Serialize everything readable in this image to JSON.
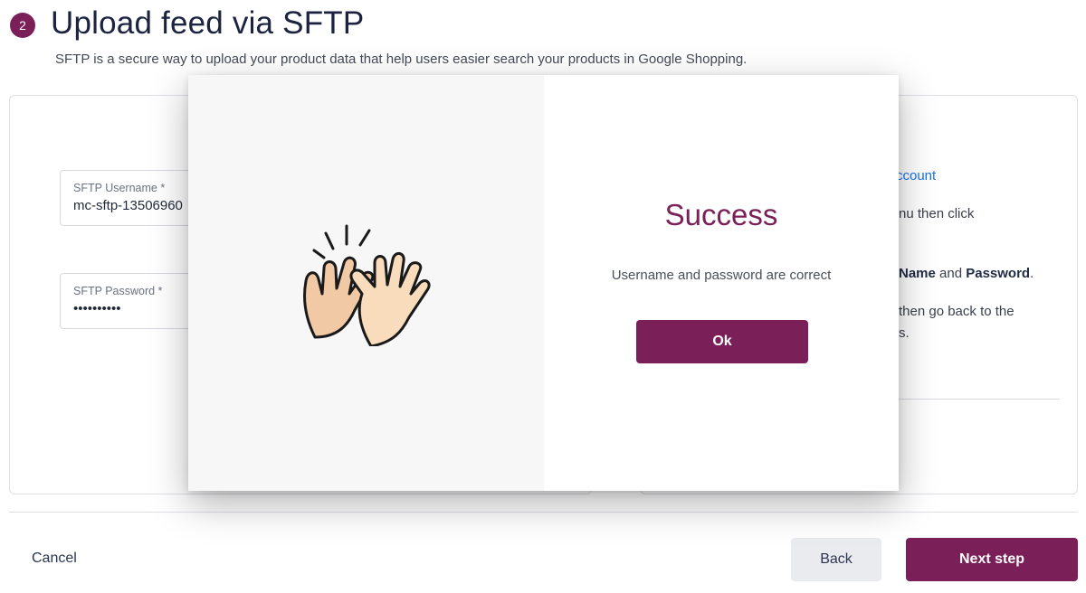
{
  "header": {
    "step_number": "2",
    "title": "Upload feed via SFTP",
    "subtitle": "SFTP is a secure way to upload your product data that help users easier search your products in Google Shopping."
  },
  "form": {
    "username": {
      "label": "SFTP Username *",
      "value": "mc-sftp-13506960"
    },
    "password": {
      "label": "SFTP Password *",
      "value": "••••••••••"
    }
  },
  "instructions": {
    "link_fragment": "ccount",
    "line2": "nu then click",
    "line3_bold1": "Name",
    "line3_mid": " and ",
    "line3_bold2": "Password",
    "line3_end": ".",
    "line4": "then go back to the",
    "line5": "s."
  },
  "footer": {
    "cancel_label": "Cancel",
    "back_label": "Back",
    "next_label": "Next step"
  },
  "modal": {
    "icon": "high-five-icon",
    "title": "Success",
    "message": "Username and password are correct",
    "ok_label": "Ok"
  },
  "colors": {
    "brand": "#7a1f57",
    "link": "#1a73e8"
  }
}
